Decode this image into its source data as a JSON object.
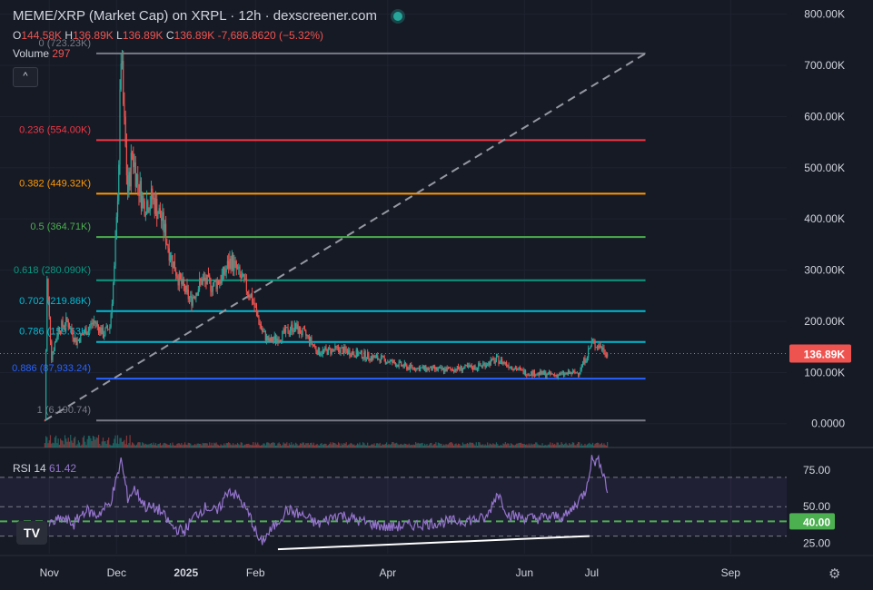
{
  "header": {
    "title": "MEME/XRP (Market Cap) on XRPL · 12h · dexscreener.com",
    "ohlc": [
      {
        "key": "O",
        "value": "144.58K"
      },
      {
        "key": "H",
        "value": "136.89K"
      },
      {
        "key": "L",
        "value": "136.89K"
      },
      {
        "key": "C",
        "value": "136.89K"
      }
    ],
    "change": "-7,686.8620 (−5.32%)",
    "volume_label": "Volume",
    "volume_value": "297",
    "rsi_label": "RSI 14",
    "rsi_value": "61.42",
    "collapse_glyph": "^"
  },
  "icons": {
    "logo": "tradingview-logo-icon",
    "logo_text": "TV",
    "settings": "settings-gear-icon",
    "settings_glyph": "⚙"
  },
  "colors": {
    "background": "#161a25",
    "grid": "#1f2330",
    "up": "#26a69a",
    "down": "#ef5350",
    "rsi": "#9575cd",
    "price_label_bg": "#ef5350",
    "rsi_40_label_bg": "#4caf50"
  },
  "chart_data": [
    {
      "type": "candlestick",
      "title": "MEME/XRP (Market Cap)",
      "ylim": [
        -20000,
        810000
      ],
      "y_ticks": [
        0,
        100000,
        200000,
        300000,
        400000,
        500000,
        600000,
        700000,
        800000
      ],
      "y_tick_labels": [
        "0.0000",
        "100.00K",
        "200.00K",
        "300.00K",
        "400.00K",
        "500.00K",
        "600.00K",
        "700.00K",
        "800.00K"
      ],
      "x_ticks": [
        {
          "label": "Nov",
          "date": "2024-11-01"
        },
        {
          "label": "Dec",
          "date": "2024-12-01"
        },
        {
          "label": "2025",
          "date": "2025-01-01"
        },
        {
          "label": "Feb",
          "date": "2025-02-01"
        },
        {
          "label": "Apr",
          "date": "2025-04-01"
        },
        {
          "label": "Jun",
          "date": "2025-06-01"
        },
        {
          "label": "Jul",
          "date": "2025-07-01"
        },
        {
          "label": "Sep",
          "date": "2025-09-01"
        }
      ],
      "x_range": [
        "2024-10-10",
        "2025-09-26"
      ],
      "last_price": 136890,
      "last_price_label": "136.89K",
      "price_series": [
        {
          "date": "2024-10-30",
          "value": 6190
        },
        {
          "date": "2024-10-31",
          "value": 280000
        },
        {
          "date": "2024-11-02",
          "value": 130000
        },
        {
          "date": "2024-11-05",
          "value": 185000
        },
        {
          "date": "2024-11-09",
          "value": 200000
        },
        {
          "date": "2024-11-13",
          "value": 160000
        },
        {
          "date": "2024-11-17",
          "value": 180000
        },
        {
          "date": "2024-11-21",
          "value": 200000
        },
        {
          "date": "2024-11-25",
          "value": 175000
        },
        {
          "date": "2024-11-28",
          "value": 190000
        },
        {
          "date": "2024-11-30",
          "value": 300000
        },
        {
          "date": "2024-12-01",
          "value": 390000
        },
        {
          "date": "2024-12-02",
          "value": 520000
        },
        {
          "date": "2024-12-03",
          "value": 723000
        },
        {
          "date": "2024-12-04",
          "value": 620000
        },
        {
          "date": "2024-12-06",
          "value": 450000
        },
        {
          "date": "2024-12-08",
          "value": 530000
        },
        {
          "date": "2024-12-10",
          "value": 480000
        },
        {
          "date": "2024-12-13",
          "value": 430000
        },
        {
          "date": "2024-12-17",
          "value": 440000
        },
        {
          "date": "2024-12-21",
          "value": 400000
        },
        {
          "date": "2024-12-25",
          "value": 330000
        },
        {
          "date": "2024-12-29",
          "value": 280000
        },
        {
          "date": "2025-01-03",
          "value": 240000
        },
        {
          "date": "2025-01-08",
          "value": 280000
        },
        {
          "date": "2025-01-13",
          "value": 270000
        },
        {
          "date": "2025-01-17",
          "value": 285000
        },
        {
          "date": "2025-01-21",
          "value": 320000
        },
        {
          "date": "2025-01-26",
          "value": 280000
        },
        {
          "date": "2025-01-30",
          "value": 250000
        },
        {
          "date": "2025-02-04",
          "value": 180000
        },
        {
          "date": "2025-02-07",
          "value": 160000
        },
        {
          "date": "2025-02-12",
          "value": 170000
        },
        {
          "date": "2025-02-18",
          "value": 190000
        },
        {
          "date": "2025-02-24",
          "value": 170000
        },
        {
          "date": "2025-03-01",
          "value": 140000
        },
        {
          "date": "2025-03-10",
          "value": 145000
        },
        {
          "date": "2025-03-20",
          "value": 135000
        },
        {
          "date": "2025-03-30",
          "value": 125000
        },
        {
          "date": "2025-04-10",
          "value": 110000
        },
        {
          "date": "2025-04-25",
          "value": 105000
        },
        {
          "date": "2025-05-10",
          "value": 110000
        },
        {
          "date": "2025-05-20",
          "value": 125000
        },
        {
          "date": "2025-06-01",
          "value": 100000
        },
        {
          "date": "2025-06-15",
          "value": 95000
        },
        {
          "date": "2025-06-25",
          "value": 100000
        },
        {
          "date": "2025-06-29",
          "value": 135000
        },
        {
          "date": "2025-07-01",
          "value": 158000
        },
        {
          "date": "2025-07-05",
          "value": 150000
        },
        {
          "date": "2025-07-08",
          "value": 136890
        }
      ],
      "fib_levels": [
        {
          "ratio": "0",
          "value": 723230,
          "label": "0 (723.23K)",
          "color": "#787b86"
        },
        {
          "ratio": "0.236",
          "value": 554000,
          "label": "0.236 (554.00K)",
          "color": "#f23645"
        },
        {
          "ratio": "0.382",
          "value": 449320,
          "label": "0.382 (449.32K)",
          "color": "#ff9800"
        },
        {
          "ratio": "0.5",
          "value": 364710,
          "label": "0.5 (364.71K)",
          "color": "#4caf50"
        },
        {
          "ratio": "0.618",
          "value": 280090,
          "label": "0.618 (280.090K)",
          "color": "#089981"
        },
        {
          "ratio": "0.702",
          "value": 219860,
          "label": "0.702 (219.86K)",
          "color": "#00bcd4"
        },
        {
          "ratio": "0.786",
          "value": 159630,
          "label": "0.786 (159.63K)",
          "color": "#00bcd4"
        },
        {
          "ratio": "0.886",
          "value": 87933.24,
          "label": "0.886 (87,933.24)",
          "color": "#2962ff"
        },
        {
          "ratio": "1",
          "value": 6190.74,
          "label": "1 (6,190.74)",
          "color": "#787b86"
        }
      ],
      "fib_start": "2024-10-30",
      "fib_end": "2025-07-25",
      "trend_line": [
        {
          "date": "2024-10-30",
          "value": 6190
        },
        {
          "date": "2025-07-25",
          "value": 723230
        }
      ]
    },
    {
      "type": "line",
      "ylim": [
        18,
        86
      ],
      "y_ticks": [
        25,
        50,
        75
      ],
      "y_tick_labels": [
        "25.00",
        "50.00",
        "75.00"
      ],
      "bands": [
        30,
        50,
        70
      ],
      "threshold": 40,
      "threshold_label": "40.00",
      "series": [
        {
          "values": [
            {
              "date": "2024-11-01",
              "value": 38
            },
            {
              "date": "2024-11-07",
              "value": 42
            },
            {
              "date": "2024-11-12",
              "value": 38
            },
            {
              "date": "2024-11-17",
              "value": 48
            },
            {
              "date": "2024-11-22",
              "value": 44
            },
            {
              "date": "2024-11-28",
              "value": 52
            },
            {
              "date": "2024-12-01",
              "value": 68
            },
            {
              "date": "2024-12-03",
              "value": 82
            },
            {
              "date": "2024-12-06",
              "value": 56
            },
            {
              "date": "2024-12-09",
              "value": 62
            },
            {
              "date": "2024-12-14",
              "value": 50
            },
            {
              "date": "2024-12-20",
              "value": 48
            },
            {
              "date": "2024-12-26",
              "value": 36
            },
            {
              "date": "2024-12-31",
              "value": 33
            },
            {
              "date": "2025-01-05",
              "value": 44
            },
            {
              "date": "2025-01-10",
              "value": 50
            },
            {
              "date": "2025-01-15",
              "value": 46
            },
            {
              "date": "2025-01-20",
              "value": 62
            },
            {
              "date": "2025-01-25",
              "value": 55
            },
            {
              "date": "2025-01-30",
              "value": 42
            },
            {
              "date": "2025-02-03",
              "value": 25
            },
            {
              "date": "2025-02-08",
              "value": 34
            },
            {
              "date": "2025-02-15",
              "value": 48
            },
            {
              "date": "2025-02-22",
              "value": 44
            },
            {
              "date": "2025-03-01",
              "value": 38
            },
            {
              "date": "2025-03-10",
              "value": 45
            },
            {
              "date": "2025-03-20",
              "value": 40
            },
            {
              "date": "2025-04-01",
              "value": 36
            },
            {
              "date": "2025-04-15",
              "value": 38
            },
            {
              "date": "2025-04-30",
              "value": 40
            },
            {
              "date": "2025-05-15",
              "value": 42
            },
            {
              "date": "2025-05-20",
              "value": 60
            },
            {
              "date": "2025-05-25",
              "value": 44
            },
            {
              "date": "2025-06-05",
              "value": 42
            },
            {
              "date": "2025-06-20",
              "value": 44
            },
            {
              "date": "2025-06-28",
              "value": 60
            },
            {
              "date": "2025-07-01",
              "value": 82
            },
            {
              "date": "2025-07-05",
              "value": 80
            },
            {
              "date": "2025-07-08",
              "value": 61.42
            }
          ]
        }
      ],
      "trend_line": [
        {
          "date": "2025-02-11",
          "value": 21
        },
        {
          "date": "2025-06-30",
          "value": 30
        }
      ]
    }
  ]
}
